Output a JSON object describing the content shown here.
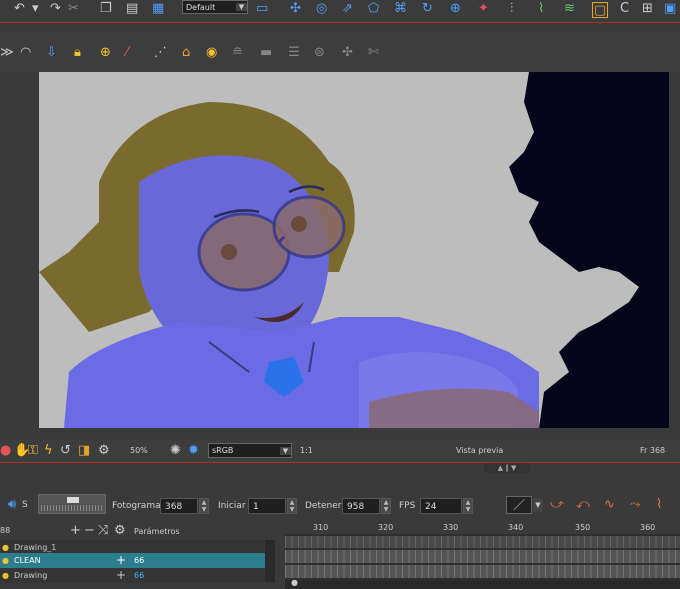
{
  "toolbar_top": {
    "preset_select": "Default"
  },
  "viewer": {
    "zoom": "50%",
    "color_space": "sRGB",
    "ratio": "1:1",
    "preview_label": "Vista previa",
    "frame_indicator": "Fr 368"
  },
  "playback": {
    "frame_label": "Fotograma",
    "frame_value": "368",
    "start_label": "Iniciar",
    "start_value": "1",
    "stop_label": "Detener",
    "stop_value": "958",
    "fps_label": "FPS",
    "fps_value": "24"
  },
  "layers": {
    "params_header": "Parámetros",
    "header_count": "88",
    "items": [
      {
        "name": "Drawing_1",
        "value": ""
      },
      {
        "name": "CLEAN",
        "value": "66"
      },
      {
        "name": "Drawing",
        "value": "66"
      }
    ]
  },
  "timeline": {
    "ticks": [
      "310",
      "320",
      "330",
      "340",
      "350",
      "360"
    ]
  },
  "colors": {
    "accent_red": "#a8312b",
    "selected_layer": "#2c7e8e",
    "value_blue": "#4db3ff"
  }
}
